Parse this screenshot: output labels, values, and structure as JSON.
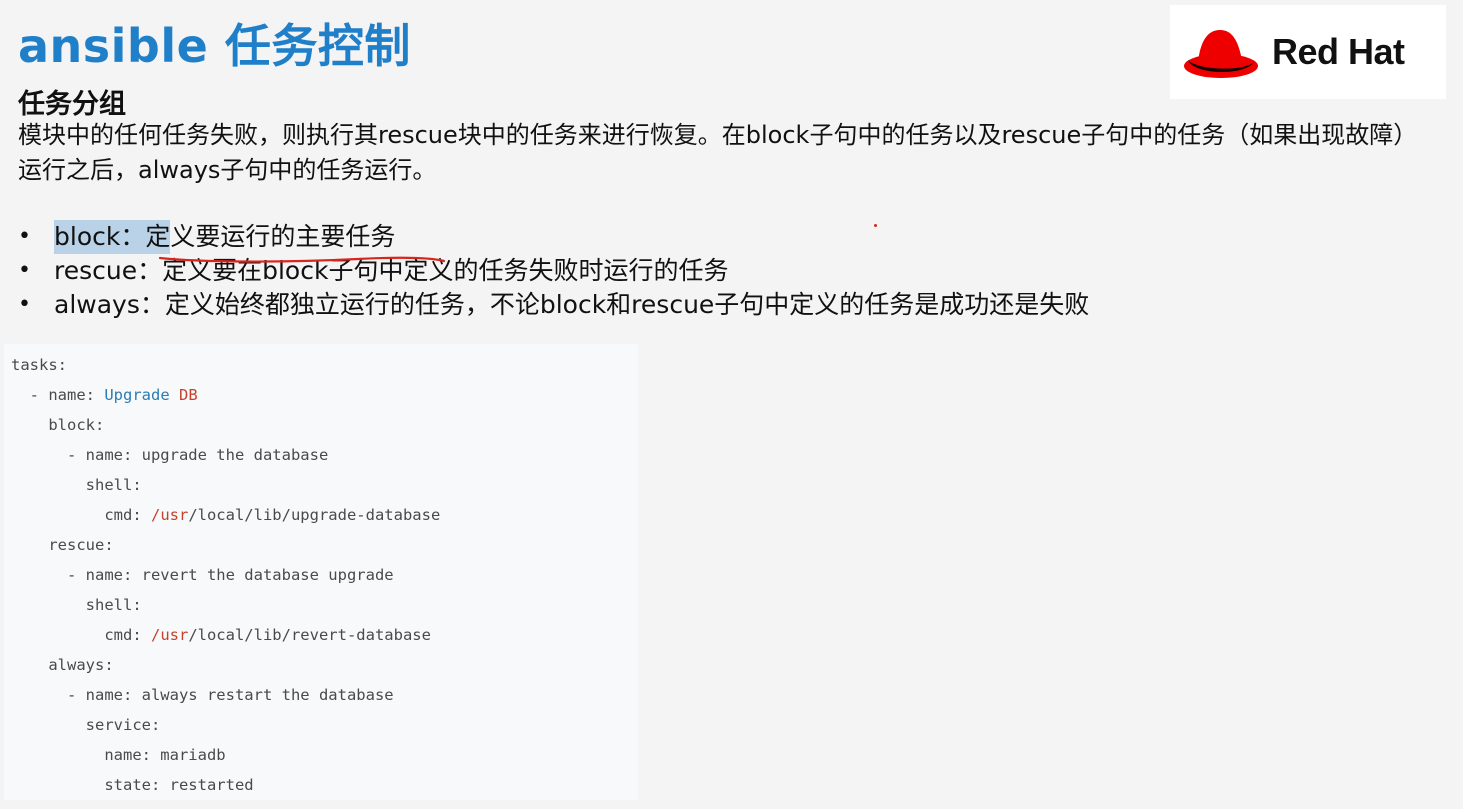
{
  "header": {
    "title": "ansible 任务控制",
    "logo_text": "Red Hat"
  },
  "section": {
    "subtitle": "任务分组",
    "paragraph": "模块中的任何任务失败，则执行其rescue块中的任务来进行恢复。在block子句中的任务以及rescue子句中的任务（如果出现故障）运行之后，always子句中的任务运行。"
  },
  "bullets": [
    {
      "term": "block",
      "highlight": "block：定",
      "rest": "义要运行的主要任务",
      "text": "block：定义要运行的主要任务"
    },
    {
      "term": "rescue",
      "text": "rescue：定义要在block子句中定义的任务失败时运行的任务"
    },
    {
      "term": "always",
      "text": "always：定义始终都独立运行的任务，不论block和rescue子句中定义的任务是成功还是失败"
    }
  ],
  "code": {
    "l1": "tasks:",
    "l2_prefix": "  - name: ",
    "l2_a": "Upgrade",
    "l2_b": " DB",
    "l3": "    block:",
    "l4": "      - name: upgrade the database",
    "l5": "        shell:",
    "l6_prefix": "          cmd: ",
    "l6_red": "/usr",
    "l6_rest": "/local/lib/upgrade-database",
    "l7": "    rescue:",
    "l8": "      - name: revert the database upgrade",
    "l9": "        shell:",
    "l10_prefix": "          cmd: ",
    "l10_red": "/usr",
    "l10_rest": "/local/lib/revert-database",
    "l11": "    always:",
    "l12": "      - name: always restart the database",
    "l13": "        service:",
    "l14": "          name: mariadb",
    "l15": "          state: restarted"
  },
  "colors": {
    "title": "#1f7fc9",
    "logo_red": "#ee0000",
    "highlight": "#b9d2e7",
    "annotation_red": "#d9261c"
  }
}
